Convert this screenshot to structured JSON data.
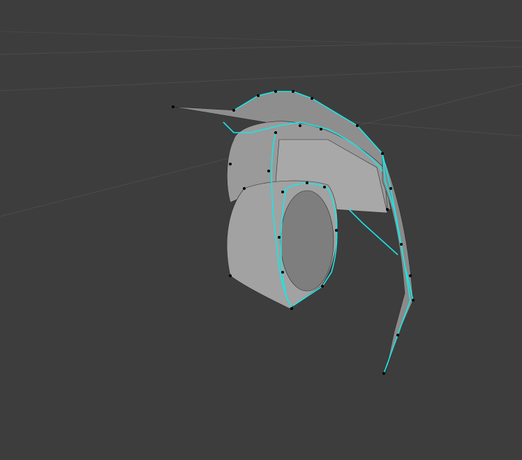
{
  "viewport": {
    "background": "#3d3d3d",
    "grid_color": "#4a4a4a",
    "mesh_color": "#a3a3a3",
    "mesh_dark": "#7c7c7c",
    "edge_color": "#2a2a2a",
    "seam_color": "#19e6e6",
    "vertex_color": "#000000"
  }
}
